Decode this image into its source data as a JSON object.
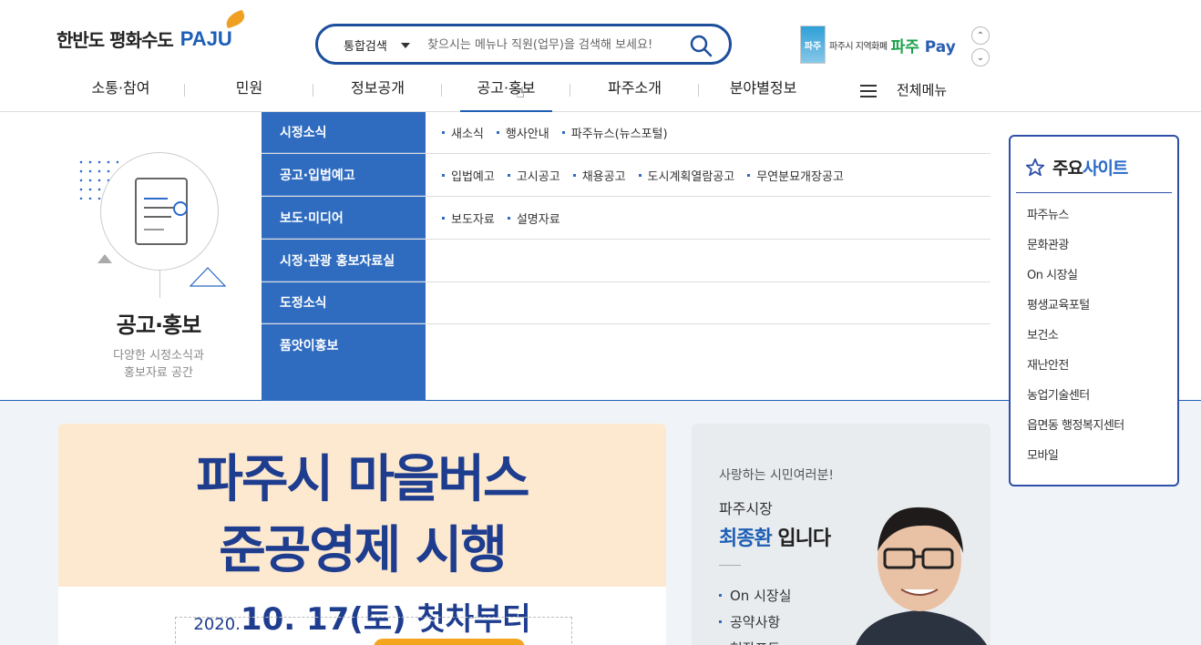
{
  "header": {
    "logo_text": "한반도 평화수도",
    "logo_brand": "PAJU",
    "search": {
      "category": "통합검색",
      "placeholder": "찾으시는 메뉴나 직원(업무)을 검색해 보세요!"
    },
    "pay": {
      "card_text": "파주",
      "caption": "파주시 지역화폐",
      "brand_a": "파주",
      "brand_b": "Pay"
    },
    "arrows": {
      "up": "⌃",
      "down": "⌄"
    },
    "nav": [
      {
        "label": "소통·참여"
      },
      {
        "label": "민원"
      },
      {
        "label": "정보공개"
      },
      {
        "label": "공고·홍보",
        "active": true
      },
      {
        "label": "파주소개"
      },
      {
        "label": "분야별정보"
      }
    ],
    "all_menu": "전체메뉴",
    "accent": "#1d5fb5"
  },
  "mega": {
    "title": "공고·홍보",
    "desc_line1": "다양한 시정소식과",
    "desc_line2": "홍보자료 공간",
    "rows": [
      {
        "category": "시정소식",
        "links": [
          "새소식",
          "행사안내",
          "파주뉴스(뉴스포털)"
        ]
      },
      {
        "category": "공고·입법예고",
        "links": [
          "입법예고",
          "고시공고",
          "채용공고",
          "도시계획열람공고",
          "무연분묘개장공고"
        ]
      },
      {
        "category": "보도·미디어",
        "links": [
          "보도자료",
          "설명자료"
        ]
      },
      {
        "category": "시정·관광 홍보자료실",
        "links": []
      },
      {
        "category": "도정소식",
        "links": []
      },
      {
        "category": "품앗이홍보",
        "links": []
      }
    ],
    "menu_color": "#2f6cc0"
  },
  "sites": {
    "title_a": "주요",
    "title_b": "사이트",
    "items": [
      "파주뉴스",
      "문화관광",
      "On 시장실",
      "평생교육포털",
      "보건소",
      "재난안전",
      "농업기술센터",
      "읍면동 행정복지센터",
      "모바일"
    ]
  },
  "banner": {
    "line1": "파주시 마을버스",
    "line2": "준공영제 시행",
    "year": "2020.",
    "date": "10. 17(토) 첫차부터"
  },
  "mayor": {
    "greeting": "사랑하는 시민여러분!",
    "role": "파주시장",
    "name": "최종환",
    "suffix": " 입니다",
    "links": [
      "On 시장실",
      "공약사항",
      "현장포토"
    ]
  }
}
